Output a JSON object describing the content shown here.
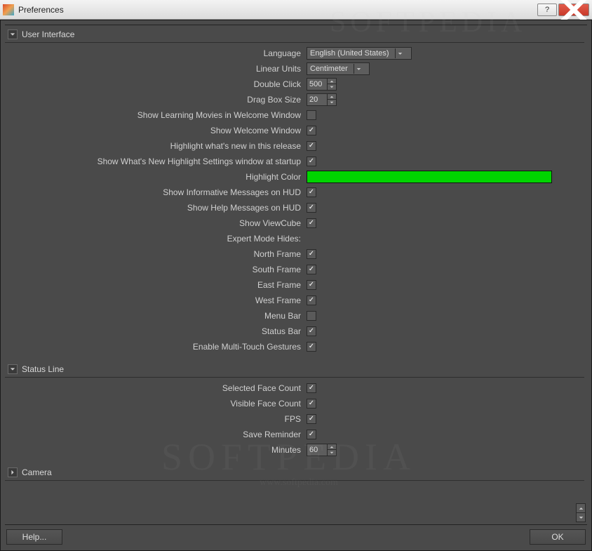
{
  "window": {
    "title": "Preferences"
  },
  "sections": {
    "user_interface": {
      "title": "User Interface",
      "expanded": true,
      "rows": {
        "language": {
          "label": "Language",
          "value": "English (United States)"
        },
        "linear_units": {
          "label": "Linear Units",
          "value": "Centimeter"
        },
        "double_click": {
          "label": "Double Click",
          "value": "500"
        },
        "drag_box_size": {
          "label": "Drag Box Size",
          "value": "20"
        },
        "show_learning_movies": {
          "label": "Show Learning Movies in Welcome Window",
          "checked": false
        },
        "show_welcome_window": {
          "label": "Show Welcome Window",
          "checked": true
        },
        "highlight_whats_new": {
          "label": "Highlight what's new in this release",
          "checked": true
        },
        "show_whats_new_highlight": {
          "label": "Show What's New Highlight Settings window at startup",
          "checked": true
        },
        "highlight_color": {
          "label": "Highlight Color",
          "value": "#00d400"
        },
        "show_info_hud": {
          "label": "Show Informative Messages on HUD",
          "checked": true
        },
        "show_help_hud": {
          "label": "Show Help Messages on HUD",
          "checked": true
        },
        "show_viewcube": {
          "label": "Show ViewCube",
          "checked": true
        },
        "expert_mode_hides": {
          "label": "Expert Mode Hides:"
        },
        "north_frame": {
          "label": "North Frame",
          "checked": true
        },
        "south_frame": {
          "label": "South Frame",
          "checked": true
        },
        "east_frame": {
          "label": "East Frame",
          "checked": true
        },
        "west_frame": {
          "label": "West Frame",
          "checked": true
        },
        "menu_bar": {
          "label": "Menu Bar",
          "checked": false
        },
        "status_bar": {
          "label": "Status Bar",
          "checked": true
        },
        "enable_multitouch": {
          "label": "Enable Multi-Touch Gestures",
          "checked": true
        }
      }
    },
    "status_line": {
      "title": "Status Line",
      "expanded": true,
      "rows": {
        "selected_face_count": {
          "label": "Selected Face Count",
          "checked": true
        },
        "visible_face_count": {
          "label": "Visible Face Count",
          "checked": true
        },
        "fps": {
          "label": "FPS",
          "checked": true
        },
        "save_reminder": {
          "label": "Save Reminder",
          "checked": true
        },
        "minutes": {
          "label": "Minutes",
          "value": "60"
        }
      }
    },
    "camera": {
      "title": "Camera",
      "expanded": false
    }
  },
  "footer": {
    "help": "Help...",
    "ok": "OK"
  },
  "watermark": {
    "text1": "SOFTPEDIA",
    "text2": "SOFTPEDIA",
    "text3": "www.softpedia.com"
  }
}
